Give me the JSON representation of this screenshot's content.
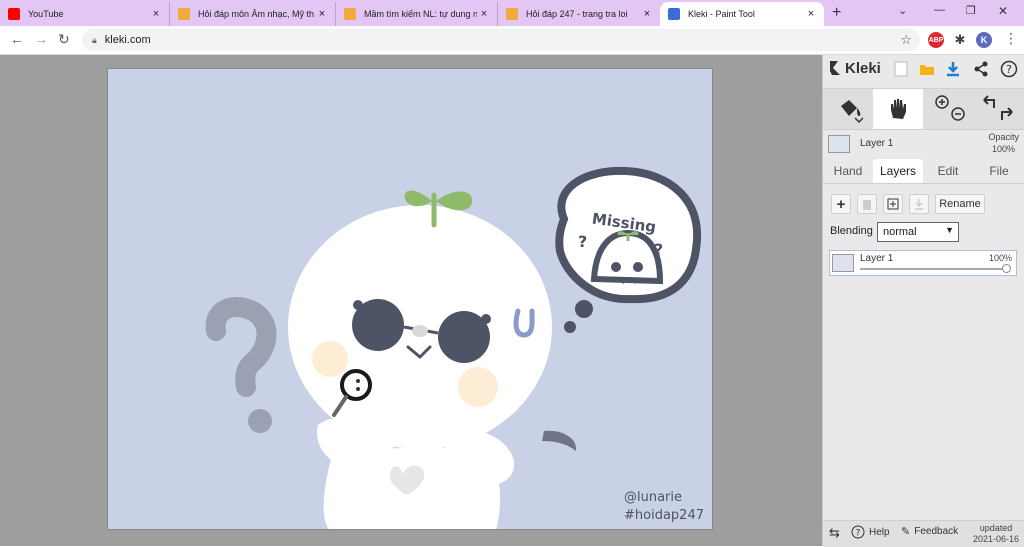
{
  "browser": {
    "tabs": [
      {
        "title": "YouTube",
        "favicon_color": "#ff0000"
      },
      {
        "title": "Hỏi đáp môn Âm nhạc, Mỹ th",
        "favicon_color": "#f2a93b"
      },
      {
        "title": "Mầm tìm kiếm NL: tự dung n",
        "favicon_color": "#f2a93b"
      },
      {
        "title": "Hỏi đáp 247 - trang tra loi",
        "favicon_color": "#f2a93b"
      },
      {
        "title": "Kleki - Paint Tool",
        "favicon_color": "#3a6bd8"
      }
    ],
    "close_glyph": "×",
    "new_tab_glyph": "+",
    "url": "kleki.com",
    "profile_initial": "K",
    "abp_label": "ABP"
  },
  "artwork": {
    "thought_text": "Missing",
    "credit_line1": "@lunarie",
    "credit_line2": "#hoidap247"
  },
  "panel": {
    "logo_text": "Kleki",
    "layer_name": "Layer 1",
    "opacity_label": "Opacity",
    "opacity_value": "100%",
    "tabs": [
      "Hand",
      "Layers",
      "Edit",
      "File"
    ],
    "rename_label": "Rename",
    "blending_label": "Blending",
    "blending_value": "normal",
    "layer_item_name": "Layer 1",
    "layer_item_opacity": "100%",
    "help_label": "Help",
    "feedback_label": "Feedback",
    "updated_label": "updated",
    "updated_date": "2021-06-16"
  },
  "colors": {
    "canvas_bg": "#c9d1e6",
    "ink": "#4e5465",
    "sprout": "#8fba6a",
    "accent_blue": "#1a7fd4"
  }
}
